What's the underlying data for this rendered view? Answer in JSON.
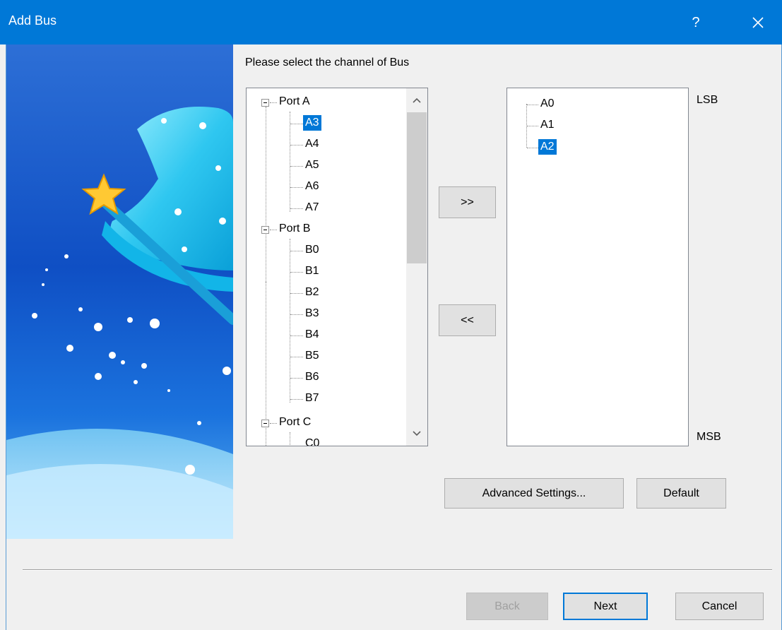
{
  "dialog": {
    "title": "Add Bus",
    "help_label": "?",
    "prompt": "Please select the channel of  Bus"
  },
  "source_tree": {
    "ports": [
      {
        "label": "Port A",
        "children": [
          "A3",
          "A4",
          "A5",
          "A6",
          "A7"
        ]
      },
      {
        "label": "Port B",
        "children": [
          "B0",
          "B1",
          "B2",
          "B3",
          "B4",
          "B5",
          "B6",
          "B7"
        ]
      },
      {
        "label": "Port C",
        "children": [
          "C0"
        ]
      }
    ],
    "selected": "A3"
  },
  "selected_list": {
    "items": [
      "A0",
      "A1",
      "A2"
    ],
    "selected": "A2"
  },
  "labels": {
    "lsb": "LSB",
    "msb": "MSB"
  },
  "buttons": {
    "add": ">>",
    "remove": "<<",
    "advanced": "Advanced Settings...",
    "default": "Default",
    "back": "Back",
    "next": "Next",
    "cancel": "Cancel"
  },
  "colors": {
    "titlebar": "#0078d7",
    "selection": "#0078d7",
    "window_bg": "#f0f0f0"
  },
  "icons": {
    "close": "close-icon",
    "scroll_up": "chevron-up-icon",
    "scroll_down": "chevron-down-icon",
    "tree_expander": "minus-box-icon"
  }
}
